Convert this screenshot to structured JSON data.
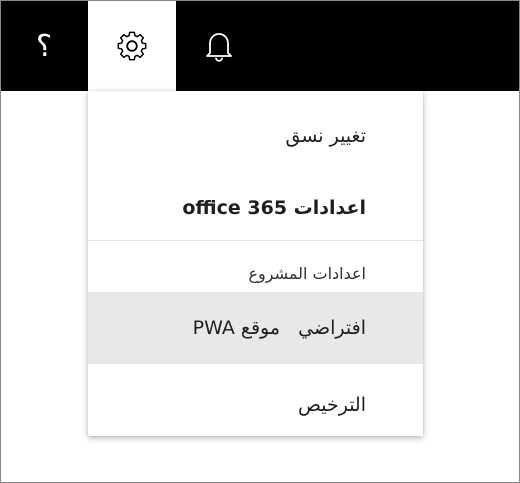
{
  "topbar": {
    "help_icon": "help-question-icon",
    "settings_icon": "gear-icon",
    "notifications_icon": "bell-icon"
  },
  "menu": {
    "change_theme": "تغيير نسق",
    "office365_settings": "اعدادات office 365",
    "section_header": "اعدادات المشروع",
    "pwa_default_site": "افتراضي   موقع PWA",
    "licensing": "الترخيص"
  },
  "colors": {
    "topbar_background": "#000000",
    "selected_tab_background": "#ffffff",
    "hover_item_background": "#e8e8e8",
    "text": "#1f1f1f"
  }
}
